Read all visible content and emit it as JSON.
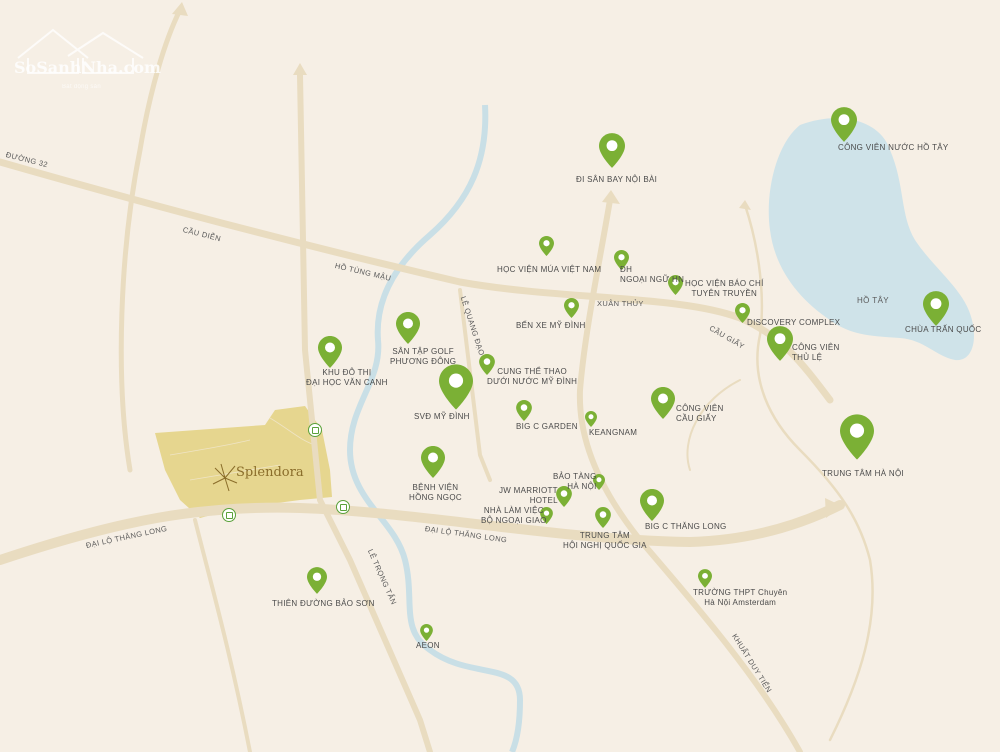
{
  "watermark": {
    "brand": "SoSanhNha.com",
    "tagline": "Bất động sản"
  },
  "project": {
    "name": "Splendora"
  },
  "colors": {
    "background": "#f6efe5",
    "road": "#e9dcc0",
    "river": "#c9dfe6",
    "lake": "#cfe3e9",
    "pin": "#7bb035",
    "project_area": "#e6d68f"
  },
  "roads": {
    "duong32": "ĐƯỜNG 32",
    "caudien": "CẦU DIỄN",
    "hotungmau": "HỒ TÙNG MẬU",
    "xuanthuy": "XUÂN THỦY",
    "caugiay": "CẦU GIẤY",
    "lequangdao": "LÊ QUANG ĐẠO",
    "dailothanglong_left": "ĐẠI LỘ THĂNG LONG",
    "dailothanglong_mid": "ĐẠI LỘ THĂNG LONG",
    "letrongtan": "LÊ TRỌNG TẤN",
    "khuatduytien": "KHUẤT DUY TIẾN",
    "hotay": "HỒ TÂY"
  },
  "places": {
    "cong_vien_nuoc": "CÔNG VIÊN NƯỚC HỒ TÂY",
    "san_bay": "ĐI SÂN BAY NỘI BÀI",
    "hoc_vien_mua": "HỌC VIỆN MÚA VIỆT NAM",
    "dh_ngoai_ngu_1": "ĐH",
    "dh_ngoai_ngu_2": "NGOẠI NGỮ HN",
    "hv_bao_chi_1": "HỌC VIỆN BÁO CHÍ",
    "hv_bao_chi_2": "TUYÊN TRUYỀN",
    "discovery": "DISCOVERY COMPLEX",
    "chua_tran_quoc": "CHÙA TRẤN QUỐC",
    "cv_thu_le_1": "CÔNG VIÊN",
    "cv_thu_le_2": "THỦ LỆ",
    "ben_xe": "BẾN XE MỸ ĐÌNH",
    "san_golf_1": "SÂN TẬP GOLF",
    "san_golf_2": "PHƯƠNG ĐÔNG",
    "khu_do_thi_1": "KHU ĐÔ THỊ",
    "khu_do_thi_2": "ĐẠI HỌC VĂN CANH",
    "cung_the_thao_1": "CUNG THỂ THAO",
    "cung_the_thao_2": "DƯỚI NƯỚC MỸ ĐÌNH",
    "svd": "SVĐ MỸ ĐÌNH",
    "big_c_garden": "BIG C GARDEN",
    "keangnam": "KEANGNAM",
    "cv_cau_giay_1": "CÔNG VIÊN",
    "cv_cau_giay_2": "CẦU GIẤY",
    "trung_tam_hn": "TRUNG TÂM HÀ NỘI",
    "benh_vien_1": "BỆNH VIỆN",
    "benh_vien_2": "HỒNG NGỌC",
    "bao_tang_1": "BẢO TÀNG",
    "bao_tang_2": "HÀ NỘI",
    "jw_1": "JW MARRIOTT",
    "jw_2": "HOTEL",
    "nha_lam_viec_1": "NHÀ LÀM VIỆC",
    "nha_lam_viec_2": "BỘ NGOẠI GIAO",
    "big_c_tl": "BIG C THĂNG LONG",
    "trung_tam_hn_qg_1": "TRUNG TÂM",
    "trung_tam_hn_qg_2": "HỘI NGHỊ QUỐC GIA",
    "thpt_1": "TRƯỜNG THPT Chuyên",
    "thpt_2": "Hà Nội Amsterdam",
    "thien_duong": "THIÊN ĐƯỜNG BẢO SƠN",
    "aeon": "AEON"
  }
}
